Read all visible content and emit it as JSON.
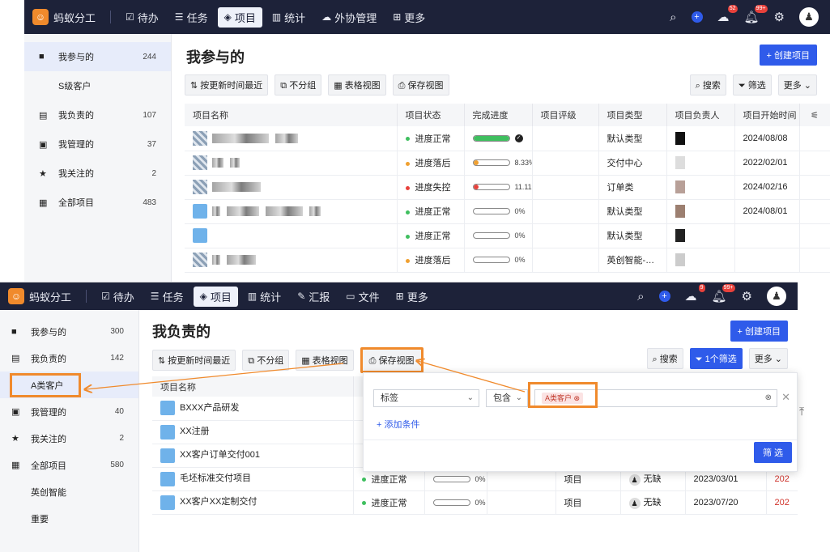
{
  "top": {
    "nav": {
      "brand": "蚂蚁分工",
      "items": [
        "待办",
        "任务",
        "项目",
        "统计",
        "外协管理",
        "更多"
      ],
      "badges": [
        "52",
        "99+"
      ]
    },
    "sidebar": [
      {
        "label": "我参与的",
        "count": "244"
      },
      {
        "label": "S级客户",
        "count": ""
      },
      {
        "label": "我负责的",
        "count": "107"
      },
      {
        "label": "我管理的",
        "count": "37"
      },
      {
        "label": "我关注的",
        "count": "2"
      },
      {
        "label": "全部项目",
        "count": "483"
      }
    ],
    "title": "我参与的",
    "create": "+ 创建项目",
    "toolbar": [
      "按更新时间最近",
      "不分组",
      "表格视图",
      "保存视图"
    ],
    "toolbar_right": [
      "搜索",
      "筛选",
      "更多"
    ],
    "columns": [
      "项目名称",
      "项目状态",
      "完成进度",
      "项目评级",
      "项目类型",
      "项目负责人",
      "项目开始时间"
    ],
    "rows": [
      {
        "status": "进度正常",
        "pct": "",
        "progress": 1.0,
        "type": "默认类型",
        "date": "2024/08/08"
      },
      {
        "status": "进度落后",
        "pct": "8.33%",
        "progress": 0.0833,
        "type": "交付中心",
        "date": "2022/02/01"
      },
      {
        "status": "进度失控",
        "pct": "11.11%",
        "progress": 0.1111,
        "type": "订单类",
        "date": "2024/02/16"
      },
      {
        "status": "进度正常",
        "pct": "0%",
        "progress": 0,
        "type": "默认类型",
        "date": "2024/08/01"
      },
      {
        "status": "进度正常",
        "pct": "0%",
        "progress": 0,
        "type": "默认类型",
        "date": ""
      },
      {
        "status": "进度落后",
        "pct": "0%",
        "progress": 0,
        "type": "英创智能-…",
        "date": ""
      }
    ]
  },
  "bottom": {
    "nav": {
      "brand": "蚂蚁分工",
      "items": [
        "待办",
        "任务",
        "项目",
        "统计",
        "汇报",
        "文件",
        "更多"
      ],
      "badges": [
        "9",
        "99+"
      ]
    },
    "sidebar": [
      {
        "label": "我参与的",
        "count": "300"
      },
      {
        "label": "我负责的",
        "count": "142"
      },
      {
        "label": "A类客户",
        "count": ""
      },
      {
        "label": "我管理的",
        "count": "40"
      },
      {
        "label": "我关注的",
        "count": "2"
      },
      {
        "label": "全部项目",
        "count": "580"
      },
      {
        "label": "英创智能",
        "count": ""
      },
      {
        "label": "重要",
        "count": ""
      }
    ],
    "title": "我负责的",
    "create": "+ 创建项目",
    "toolbar": [
      "按更新时间最近",
      "不分组",
      "表格视图",
      "保存视图"
    ],
    "toolbar_right": [
      "搜索",
      "1个筛选",
      "更多"
    ],
    "column": "项目名称",
    "rows": [
      {
        "name": "BXXX产品研发",
        "status": "",
        "pct": "",
        "type": "",
        "owner": "",
        "date": ""
      },
      {
        "name": "XX注册",
        "status": "",
        "pct": "",
        "type": "",
        "owner": "",
        "date": ""
      },
      {
        "name": "XX客户订单交付001",
        "status": "",
        "pct": "",
        "type": "",
        "owner": "",
        "date": ""
      },
      {
        "name": "毛坯标准交付项目",
        "status": "进度正常",
        "pct": "0%",
        "type": "项目",
        "owner": "无缺",
        "date": "2023/03/01",
        "extra": "202"
      },
      {
        "name": "XX客户XX定制交付",
        "status": "进度正常",
        "pct": "0%",
        "type": "项目",
        "owner": "无缺",
        "date": "2023/07/20",
        "extra": "202"
      }
    ],
    "filter": {
      "field": "标签",
      "op": "包含",
      "tag": "A类客户",
      "add": "+ 添加条件",
      "submit": "筛 选"
    }
  },
  "colors": {
    "nav": "#1d2239",
    "accent": "#2f5bea",
    "highlight": "#f08a2c",
    "ok": "#3fbf5f",
    "late": "#f0a030",
    "lost": "#e8413b"
  }
}
